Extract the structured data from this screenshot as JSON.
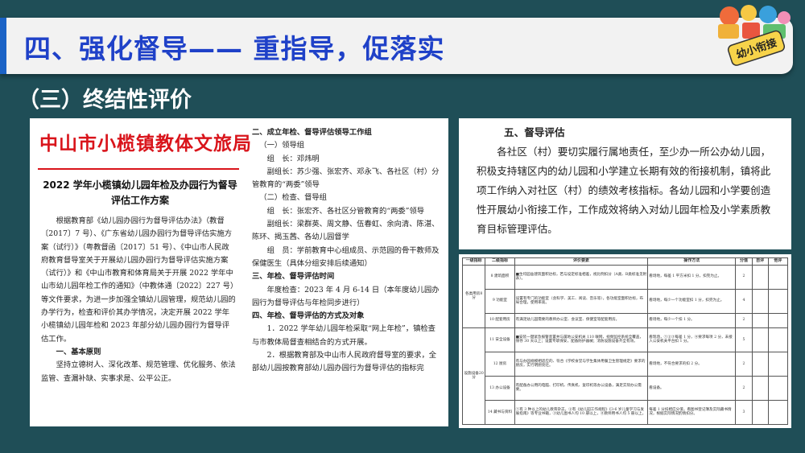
{
  "slide": {
    "title": "四、强化督导—— 重指导，促落实",
    "subtitle": "（三）终结性评价",
    "logo_text": "幼小衔接"
  },
  "document": {
    "header": "中山市小榄镇教体文旅局",
    "title": "2022 学年小榄镇幼儿园年检及办园行为督导评估工作方案",
    "left_paragraphs": [
      "根据教育部《幼儿园办园行为督导评估办法》（教督〔2017〕7 号）、《广东省幼儿园办园行为督导评估实施方案（试行）》（粤教督函〔2017〕51 号）、《中山市人民政府教育督导室关于开展幼儿园办园行为督导评估实施方案（试行）》和《中山市教育和体育局关于开展 2022 学年中山市幼儿园年检工作的通知》（中教体通〔2022〕227 号）等文件要求，为进一步加强全镇幼儿园管理，规范幼儿园的办学行为，检查和评价其办学情况，决定开展 2022 学年小榄镇幼儿园年检和 2023 年部分幼儿园办园行为督导评估工作。"
    ],
    "section1_heading": "一、基本原则",
    "section1_text": "坚持立德树人、深化改革、规范管理、优化服务、依法监管、查漏补缺、实事求是、公平公正。",
    "right_lines": [
      {
        "text": "二、成立年检、督导评估领导工作组",
        "style": "b"
      },
      {
        "text": "（一）领导组",
        "style": "ind1"
      },
      {
        "text": "组　长：邓炜明",
        "style": "ind"
      },
      {
        "text": "副组长：苏少强、张宏齐、邓永飞、各社区（村）分管教育的“两委”领导",
        "style": "ind"
      },
      {
        "text": "（二）检查、督导组",
        "style": "ind1"
      },
      {
        "text": "组　长：张宏齐、各社区分管教育的“两委”领导",
        "style": "ind"
      },
      {
        "text": "副组长：梁群英、周文静、伍春虹、余向清、陈湛、陈环、揭玉茜、各幼儿园督学",
        "style": "ind"
      },
      {
        "text": "组　员：学前教育中心组成员、示范园的骨干教师及保健医生（具体分组安排后续通知）",
        "style": "ind"
      },
      {
        "text": "三、年检、督导评估时间",
        "style": "b"
      },
      {
        "text": "年度检查：2023 年 4 月 6-14 日（本年度幼儿园办园行为督导评估与年检同步进行）",
        "style": "ind"
      },
      {
        "text": "四、年检、督导评估的方式及对象",
        "style": "b"
      },
      {
        "text": "1．2022 学年幼儿园年检采取“网上年检”，镇检查与市教体局督查相结合的方式开展。",
        "style": "ind"
      },
      {
        "text": "2．根据教育部及中山市人民政府督导室的要求，全部幼儿园按教育部幼儿园办园行为督导评估的指标完",
        "style": "ind"
      }
    ]
  },
  "supervision": {
    "heading": "五、督导评估",
    "text": "各社区（村）要切实履行属地责任，至少办一所公办幼儿园，积极支持辖区内的幼儿园和小学建立长期有效的衔接机制，镇将此项工作纳入对社区（村）的绩效考核指标。各幼儿园和小学要创造性开展幼小衔接工作，工作成效将纳入对幼儿园年检及小学素质教育目标管理评估。"
  },
  "eval_table": {
    "headers": [
      "一级指标",
      "二级指标",
      "评价要素",
      "操作方法",
      "分值",
      "自评",
      "他评"
    ],
    "rows": [
      {
        "l1": "各类用房8分",
        "l2": "8 建筑面积",
        "req": "■生均园舍建筑面积达标，若与设定标准相差，视比例扣分（A类、B类标准见附表）。",
        "op": "看场地，每差 1 平方米扣 1 分，扣完为止。",
        "score": "2"
      },
      {
        "l1": "",
        "l2": "9 功能室",
        "req": "设置有专门的功能室（含科学、美工、阅读、音乐等），各功能室面积达标，布局合理，使用率高。",
        "op": "看场地，每少一个功能室扣 1 分，扣完为止。",
        "score": "4"
      },
      {
        "l1": "",
        "l2": "10 配套用房",
        "req": "有满足幼儿园需要的教师办公室、会议室、保健室等配套用房。",
        "op": "看场地，每少一个扣 1 分。",
        "score": "2"
      },
      {
        "l1": "设施设备20分",
        "l2": "11 安全设备",
        "req": "■安装一键紧急报警装置并与属地公安机关 110 联网，视频监控系统全覆盖，保存 30 天以上；设置专职保安，配备防护器械；消防设施设备齐全有效。",
        "op": "看现场，①②③每差 1 分，④要求每项 2 分，未接入公安机关平台扣 1 分。",
        "score": "5"
      },
      {
        "l1": "",
        "l2": "12 厨房",
        "req": "有与办园规模相适应的、符合《学校食堂与学生集体用餐卫生管理规定》要求的厨房，实行明厨亮灶。",
        "op": "看场地，不符合要求的扣 2 分。",
        "score": "2"
      },
      {
        "l1": "",
        "l2": "13 办公设备",
        "req": "有配备办公用的电脑、打印机、传真机、复印机等办公设备，满足实际办公需要。",
        "op": "看设备。",
        "score": "2"
      },
      {
        "l1": "",
        "l2": "14 藏书与资料",
        "req": "①有 3 种以上的幼儿教育杂志，②有《幼儿园工作规程》《3-6 岁儿童学习与发展指南》等专业书籍，③幼儿图书人均 10 册以上，④教师用书人均 5 册以上。",
        "op": "每差 1 分扣相应分值，看图书登记簿及实际藏书情况，根据实际情况酌情扣分。",
        "score": "3"
      }
    ]
  }
}
